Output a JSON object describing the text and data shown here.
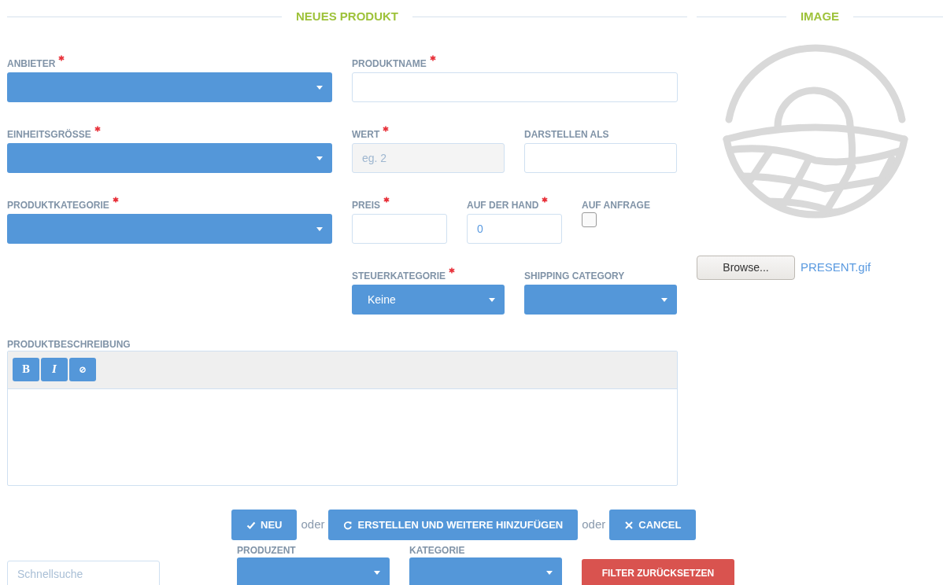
{
  "headings": [
    {
      "title": "NEUES PRODUKT"
    },
    {
      "title": "IMAGE"
    }
  ],
  "rows": [
    {
      "left": {
        "label": "ANBIETER",
        "required": true,
        "kind": "select"
      },
      "right": [
        {
          "label": "PRODUKTNAME",
          "required": true,
          "kind": "input"
        }
      ]
    },
    {
      "left": {
        "label": "EINHEITSGRÖSSE",
        "required": true,
        "kind": "select"
      },
      "right": [
        {
          "label": "WERT",
          "required": true,
          "kind": "input",
          "placeholder": "eg. 2",
          "disabled": true
        },
        {
          "label": "DARSTELLEN ALS",
          "required": false,
          "kind": "input"
        }
      ]
    },
    {
      "left": {
        "label": "PRODUKTKATEGORIE",
        "required": true,
        "kind": "select"
      },
      "right": [
        {
          "label": "PREIS",
          "required": true,
          "kind": "input"
        },
        {
          "label": "AUF DER HAND",
          "required": true,
          "kind": "input",
          "value": "0"
        },
        {
          "label": "AUF ANFRAGE",
          "required": false,
          "kind": "checkbox",
          "checked": false
        }
      ]
    },
    {
      "right": [
        {
          "label": "STEUERKATEGORIE",
          "required": true,
          "kind": "select",
          "value": "Keine"
        },
        {
          "label": "SHIPPING CATEGORY",
          "required": false,
          "kind": "select"
        }
      ]
    }
  ],
  "description": {
    "label": "PRODUKTBESCHREIBUNG",
    "tools": [
      {
        "kind": "bold",
        "text": "B"
      },
      {
        "kind": "italic",
        "text": "I"
      },
      {
        "kind": "clear",
        "text": "⊘"
      }
    ]
  },
  "image": {
    "browse": "Browse...",
    "filename": "PRESENT.gif"
  },
  "actions": [
    {
      "kind": "confirm",
      "text": "NEU"
    },
    {
      "kind": "text",
      "text": "oder"
    },
    {
      "kind": "repeat",
      "text": "ERSTELLEN UND WEITERE HINZUFÜGEN"
    },
    {
      "kind": "text",
      "text": "oder"
    },
    {
      "kind": "cancel",
      "text": "CANCEL"
    }
  ],
  "filters": {
    "search_placeholder": "Schnellsuche",
    "selects": [
      {
        "label": "PRODUZENT"
      },
      {
        "label": "KATEGORIE"
      }
    ],
    "reset": "FILTER ZURÜCKSETZEN"
  }
}
